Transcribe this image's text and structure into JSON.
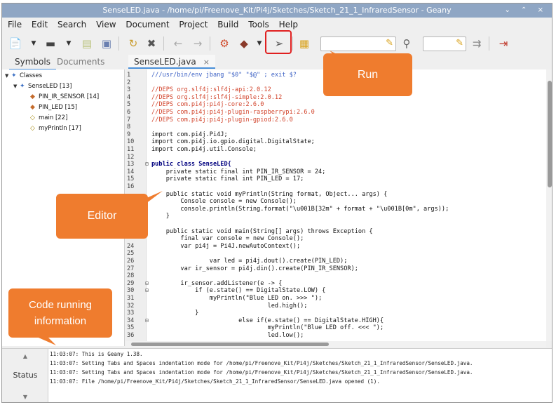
{
  "window": {
    "title": "SenseLED.java - /home/pi/Freenove_Kit/Pi4j/Sketches/Sketch_21_1_InfraredSensor - Geany",
    "controls": "⌄ ⌃ ×"
  },
  "menu": [
    "File",
    "Edit",
    "Search",
    "View",
    "Document",
    "Project",
    "Build",
    "Tools",
    "Help"
  ],
  "sidebar": {
    "tabs": [
      "Symbols",
      "Documents"
    ],
    "tree": [
      {
        "label": "Classes",
        "kind": "group"
      },
      {
        "label": "SenseLED [13]",
        "kind": "class"
      },
      {
        "label": "PIN_IR_SENSOR [14]",
        "kind": "field"
      },
      {
        "label": "PIN_LED [15]",
        "kind": "field"
      },
      {
        "label": "main [22]",
        "kind": "method"
      },
      {
        "label": "myPrintln [17]",
        "kind": "method"
      }
    ]
  },
  "editor": {
    "tab": "SenseLED.java",
    "tab_close": "×",
    "lines": [
      {
        "n": "1",
        "fold": "",
        "text": "///usr/bin/env jbang \"$0\" \"$@\" ; exit $?",
        "cls": "t-she"
      },
      {
        "n": "2",
        "fold": "",
        "text": "",
        "cls": "t-pl"
      },
      {
        "n": "3",
        "fold": "",
        "text": "//DEPS org.slf4j:slf4j-api:2.0.12",
        "cls": "t-cmt"
      },
      {
        "n": "4",
        "fold": "",
        "text": "//DEPS org.slf4j:slf4j-simple:2.0.12",
        "cls": "t-cmt"
      },
      {
        "n": "5",
        "fold": "",
        "text": "//DEPS com.pi4j:pi4j-core:2.6.0",
        "cls": "t-cmt"
      },
      {
        "n": "6",
        "fold": "",
        "text": "//DEPS com.pi4j:pi4j-plugin-raspberrypi:2.6.0",
        "cls": "t-cmt"
      },
      {
        "n": "7",
        "fold": "",
        "text": "//DEPS com.pi4j:pi4j-plugin-gpiod:2.6.0",
        "cls": "t-cmt"
      },
      {
        "n": "8",
        "fold": "",
        "text": "",
        "cls": "t-pl"
      },
      {
        "n": "9",
        "fold": "",
        "text": "import com.pi4j.Pi4J;",
        "cls": "t-pl"
      },
      {
        "n": "10",
        "fold": "",
        "text": "import com.pi4j.io.gpio.digital.DigitalState;",
        "cls": "t-pl"
      },
      {
        "n": "11",
        "fold": "",
        "text": "import com.pi4j.util.Console;",
        "cls": "t-pl"
      },
      {
        "n": "12",
        "fold": "",
        "text": "",
        "cls": "t-pl"
      },
      {
        "n": "13",
        "fold": "⊟",
        "text": "public class SenseLED{",
        "cls": "t-kw"
      },
      {
        "n": "14",
        "fold": "",
        "text": "    private static final int PIN_IR_SENSOR = 24;",
        "cls": "t-pl"
      },
      {
        "n": "15",
        "fold": "",
        "text": "    private static final int PIN_LED = 17;",
        "cls": "t-pl"
      },
      {
        "n": "16",
        "fold": "",
        "text": "",
        "cls": "t-pl"
      },
      {
        "n": "",
        "fold": "",
        "text": "    public static void myPrintln(String format, Object... args) {",
        "cls": "t-pl"
      },
      {
        "n": "",
        "fold": "",
        "text": "        Console console = new Console();",
        "cls": "t-pl"
      },
      {
        "n": "",
        "fold": "",
        "text": "        console.println(String.format(\"\\u001B[32m\" + format + \"\\u001B[0m\", args));",
        "cls": "t-pl"
      },
      {
        "n": "",
        "fold": "",
        "text": "    }",
        "cls": "t-pl"
      },
      {
        "n": "",
        "fold": "",
        "text": "",
        "cls": "t-pl"
      },
      {
        "n": "",
        "fold": "",
        "text": "    public static void main(String[] args) throws Exception {",
        "cls": "t-pl"
      },
      {
        "n": "",
        "fold": "",
        "text": "        final var console = new Console();",
        "cls": "t-pl"
      },
      {
        "n": "24",
        "fold": "",
        "text": "        var pi4j = Pi4J.newAutoContext();",
        "cls": "t-pl"
      },
      {
        "n": "25",
        "fold": "",
        "text": "",
        "cls": "t-pl"
      },
      {
        "n": "26",
        "fold": "",
        "text": "                var led = pi4j.dout().create(PIN_LED);",
        "cls": "t-pl"
      },
      {
        "n": "27",
        "fold": "",
        "text": "        var ir_sensor = pi4j.din().create(PIN_IR_SENSOR);",
        "cls": "t-pl"
      },
      {
        "n": "28",
        "fold": "",
        "text": "",
        "cls": "t-pl"
      },
      {
        "n": "29",
        "fold": "⊟",
        "text": "        ir_sensor.addListener(e -> {",
        "cls": "t-pl"
      },
      {
        "n": "30",
        "fold": "⊟",
        "text": "            if (e.state() == DigitalState.LOW) {",
        "cls": "t-pl"
      },
      {
        "n": "31",
        "fold": "",
        "text": "                myPrintln(\"Blue LED on. >>> \");",
        "cls": "t-pl"
      },
      {
        "n": "32",
        "fold": "",
        "text": "                                led.high();",
        "cls": "t-pl"
      },
      {
        "n": "33",
        "fold": "",
        "text": "            }",
        "cls": "t-pl"
      },
      {
        "n": "34",
        "fold": "⊟",
        "text": "                        else if(e.state() == DigitalState.HIGH){",
        "cls": "t-pl"
      },
      {
        "n": "35",
        "fold": "",
        "text": "                                myPrintln(\"Blue LED off. <<< \");",
        "cls": "t-pl"
      },
      {
        "n": "36",
        "fold": "",
        "text": "                                led.low();",
        "cls": "t-pl"
      }
    ]
  },
  "messages": {
    "tab": "Status",
    "lines": [
      "11:03:07: This is Geany 1.38.",
      "11:03:07: Setting Tabs and Spaces indentation mode for /home/pi/Freenove_Kit/Pi4j/Sketches/Sketch_21_1_InfraredSensor/SenseLED.java.",
      "11:03:07: Setting Tabs and Spaces indentation mode for /home/pi/Freenove_Kit/Pi4j/Sketches/Sketch_21_1_InfraredSensor/SenseLED.java.",
      "11:03:07: File /home/pi/Freenove_Kit/Pi4j/Sketches/Sketch_21_1_InfraredSensor/SenseLED.java opened (1)."
    ]
  },
  "callouts": {
    "run": "Run",
    "editor": "Editor",
    "info_line1": "Code running",
    "info_line2": "information"
  },
  "colors": {
    "callout": "#ef7c2e",
    "highlight": "#e02020",
    "titlebar": "#8fa6c4"
  }
}
